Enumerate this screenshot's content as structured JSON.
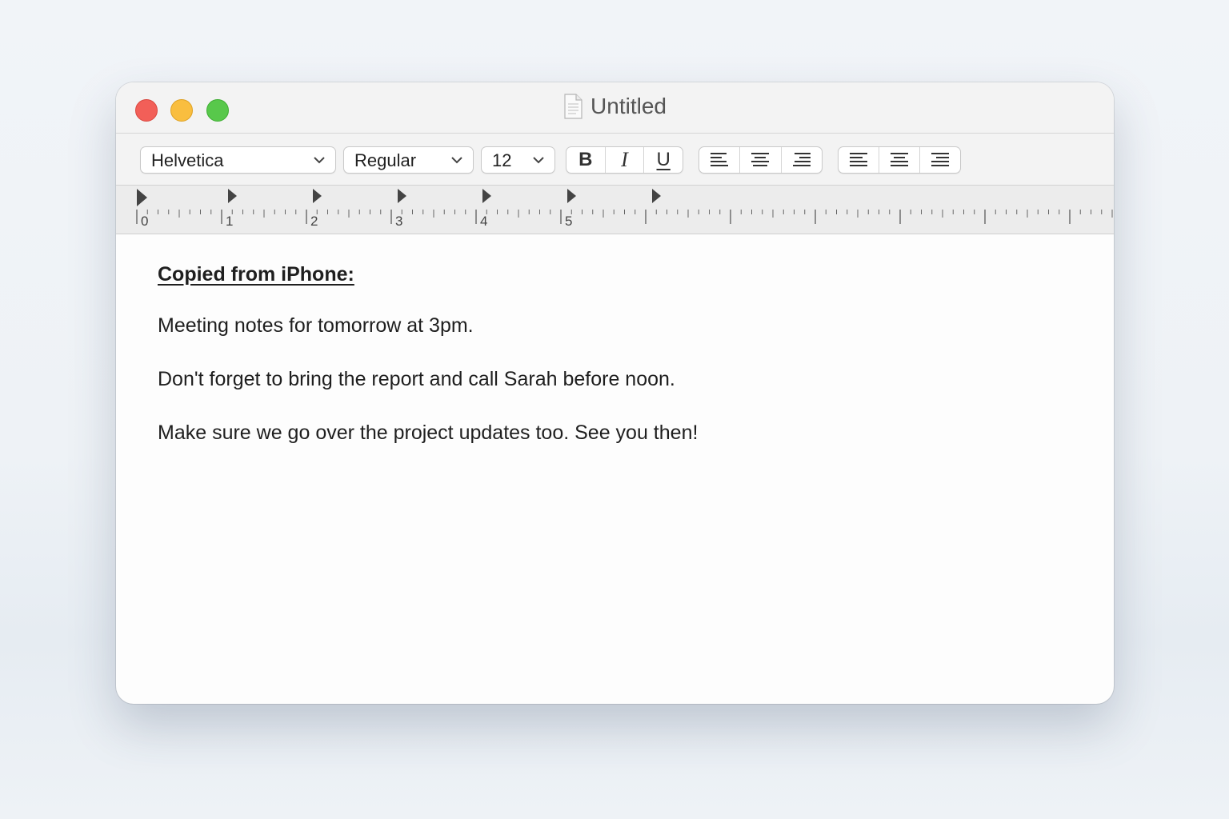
{
  "window": {
    "title": "Untitled"
  },
  "toolbar": {
    "font_family": "Helvetica",
    "font_style": "Regular",
    "font_size": "12",
    "bold_label": "B",
    "italic_label": "I",
    "underline_label": "U"
  },
  "ruler": {
    "labels": [
      "0",
      "1",
      "2",
      "3",
      "4",
      "5"
    ]
  },
  "document": {
    "heading": "Copied from iPhone:",
    "paragraphs": [
      "Meeting notes for tomorrow at 3pm.",
      "Don't forget to bring the report and call Sarah before noon.",
      "Make sure we go over the project updates too. See you then!"
    ]
  },
  "colors": {
    "close": "#f25f58",
    "minimize": "#f9be3f",
    "zoom": "#58c84b"
  }
}
